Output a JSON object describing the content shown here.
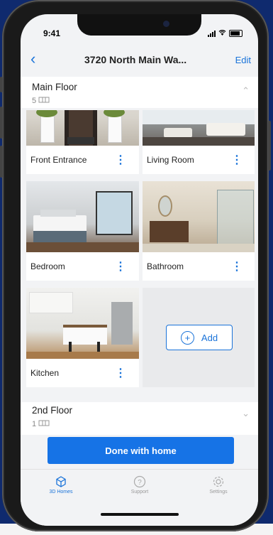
{
  "status": {
    "time": "9:41",
    "wifi_icon": "wifi-icon"
  },
  "nav": {
    "back_icon": "chevron-left-icon",
    "title": "3720 North Main Wa...",
    "edit_label": "Edit"
  },
  "floors": [
    {
      "name": "Main Floor",
      "count": "5",
      "expanded": true
    },
    {
      "name": "2nd Floor",
      "count": "1",
      "expanded": false
    }
  ],
  "rooms": [
    {
      "label": "Front Entrance"
    },
    {
      "label": "Living Room"
    },
    {
      "label": "Bedroom"
    },
    {
      "label": "Bathroom"
    },
    {
      "label": "Kitchen"
    }
  ],
  "add_label": "Add",
  "done_label": "Done with home",
  "tabs": [
    {
      "label": "3D Homes",
      "icon": "cube-icon",
      "active": true
    },
    {
      "label": "Support",
      "icon": "question-icon",
      "active": false
    },
    {
      "label": "Settings",
      "icon": "gear-icon",
      "active": false
    }
  ],
  "colors": {
    "accent": "#1a73d9",
    "button": "#1673e6",
    "background": "#0f2a6e"
  }
}
